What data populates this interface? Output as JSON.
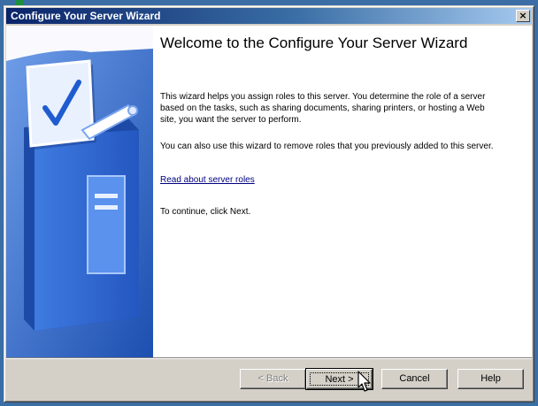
{
  "window": {
    "title": "Configure Your Server Wizard",
    "close_glyph": "×"
  },
  "main": {
    "heading": "Welcome to the Configure Your Server Wizard",
    "paragraph1": "This wizard helps you assign roles to this server. You determine the role of a server based on the tasks, such as sharing documents, sharing printers, or hosting a Web site, you want the server to perform.",
    "paragraph2": "You can also use this wizard to remove roles that you previously added to this server.",
    "link": "Read about server roles",
    "continue_text": "To continue, click Next."
  },
  "buttons": {
    "back": "< Back",
    "next": "Next >",
    "cancel": "Cancel",
    "help": "Help"
  },
  "state": {
    "back_enabled": false,
    "default_button": "next"
  },
  "colors": {
    "titlebar_start": "#0a246a",
    "titlebar_end": "#a6caf0",
    "panel_blue": "#2b62c0",
    "link": "#000080",
    "dialog_face": "#d4d0c8"
  },
  "icons": {
    "left_panel_art": "checklist-server-illustration",
    "cursor": "arrow-cursor"
  }
}
